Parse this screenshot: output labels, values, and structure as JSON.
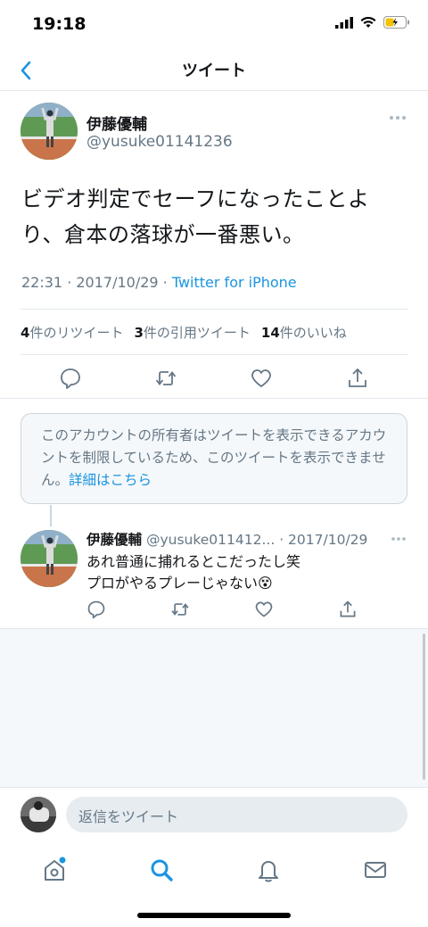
{
  "status_bar": {
    "time": "19:18"
  },
  "nav": {
    "title": "ツイート"
  },
  "tweet": {
    "display_name": "伊藤優輔",
    "handle": "@yusuke01141236",
    "text_line1": "ビデオ判定でセーフになったことよ",
    "text_line2": "り、倉本の落球が一番悪い。",
    "time": "22:31 · 2017/10/29 · ",
    "source": "Twitter for iPhone",
    "stats": {
      "retweets_count": "4",
      "retweets_label": "件のリツイート",
      "quotes_count": "3",
      "quotes_label": "件の引用ツイート",
      "likes_count": "14",
      "likes_label": "件のいいね"
    }
  },
  "notice": {
    "text": "このアカウントの所有者はツイートを表示できるアカウントを制限しているため、このツイートを表示できません。",
    "link": "詳細はこちら"
  },
  "reply": {
    "display_name": "伊藤優輔",
    "handle": "@yusuke011412...",
    "date": " · 2017/10/29",
    "line1": "あれ普通に捕れるとこだったし笑",
    "line2": "プロがやるプレーじゃない😵"
  },
  "compose": {
    "placeholder": "返信をツイート"
  },
  "colors": {
    "accent": "#1b95e0",
    "secondary_text": "#657786",
    "border": "#e1e8ed"
  },
  "icons": [
    "chevron-left-icon",
    "more-icon",
    "reply-icon",
    "retweet-icon",
    "like-icon",
    "share-icon",
    "home-icon",
    "search-icon",
    "notifications-icon",
    "messages-icon"
  ]
}
